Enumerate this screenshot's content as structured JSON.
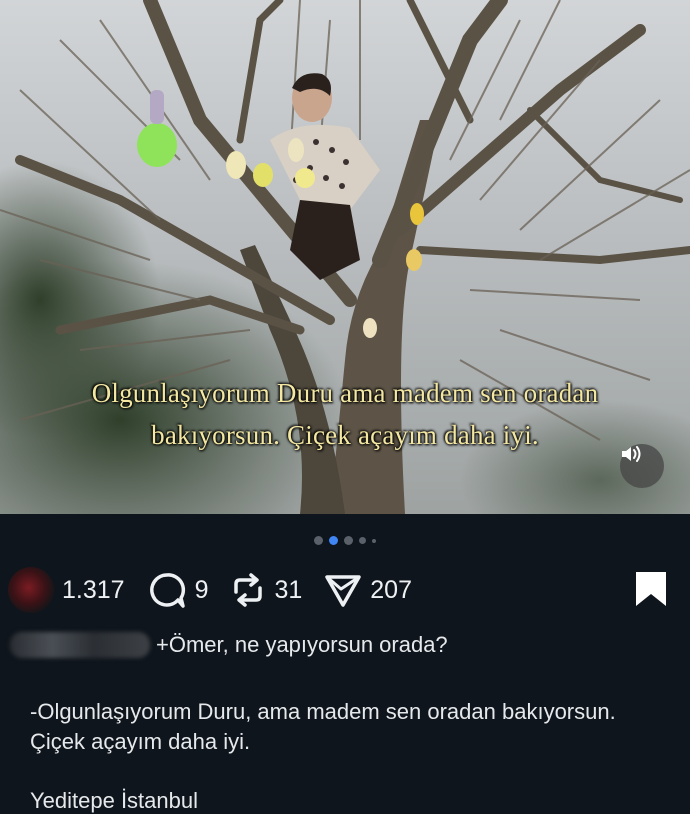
{
  "media": {
    "subtitle_line1": "Olgunlaşıyorum Duru ama madem sen oradan",
    "subtitle_line2": "bakıyorsun. Çiçek açayım daha iyi.",
    "sound_icon": "speaker-icon"
  },
  "carousel": {
    "count": 5,
    "active_index": 1
  },
  "actions": {
    "likes": "1.317",
    "comments": "9",
    "reposts": "31",
    "shares": "207"
  },
  "post": {
    "caption": "+Ömer, ne yapıyorsun orada?",
    "body": "-Olgunlaşıyorum Duru, ama madem sen oradan bakıyorsun. Çiçek açayım daha iyi.",
    "location": "Yeditepe İstanbul"
  },
  "colors": {
    "background": "#0f151c",
    "accent": "#3f86f4",
    "subtitle": "#f3e7a2"
  }
}
